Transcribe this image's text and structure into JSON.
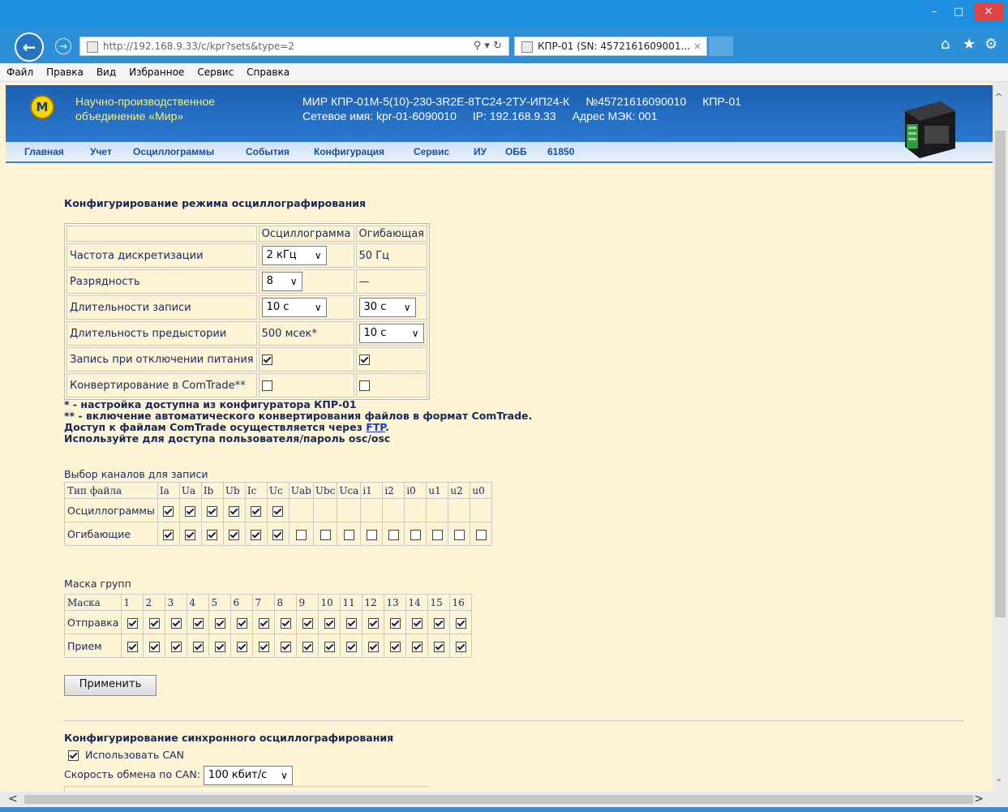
{
  "browser": {
    "url": "http://192.168.9.33/c/kpr?sets&type=2",
    "tab_title": "КПР-01 (SN: 4572161609001...",
    "tab_close": "×",
    "menu": [
      "Файл",
      "Правка",
      "Вид",
      "Избранное",
      "Сервис",
      "Справка"
    ],
    "window_buttons": {
      "minimize": "–",
      "maximize": "□",
      "close": "✕"
    }
  },
  "header": {
    "org_line1": "Научно-производственное",
    "org_line2": "объединение «Мир»",
    "model": "МИР КПР-01М-5(10)-230-3R2E-8TC24-2TУ-ИП24-К",
    "serial": "№45721616090010",
    "device": "КПР-01",
    "network_name": "Сетевое имя: kpr-01-6090010",
    "ip": "IP: 192.168.9.33",
    "iec_address": "Адрес МЭК: 001",
    "logo_text": "М"
  },
  "nav": [
    "Главная",
    "Учет",
    "Осциллограммы",
    "События",
    "Конфигурация",
    "Сервис",
    "ИУ",
    "ОББ",
    "61850"
  ],
  "oscillo_config": {
    "title": "Конфигурирование режима осциллографирования",
    "col_oscillogram": "Осциллограмма",
    "col_envelope": "Огибающая",
    "rows": {
      "sampling": {
        "label": "Частота дискретизации",
        "osc": "2 кГц",
        "env": "50 Гц"
      },
      "bits": {
        "label": "Разрядность",
        "osc": "8",
        "env": "—"
      },
      "duration": {
        "label": "Длительности записи",
        "osc": "10 с",
        "env": "30 с"
      },
      "prehistory": {
        "label": "Длительность предыстории",
        "osc": "500 мсек*",
        "env": "10 с"
      },
      "power_off": {
        "label": "Запись при отключении питания",
        "osc": true,
        "env": true
      },
      "comtrade": {
        "label": "Конвертирование в ComTrade**",
        "osc": false,
        "env": false
      }
    }
  },
  "notes": {
    "line1": "* - настройка доступна из конфигуратора КПР-01",
    "line2": "** - включение автоматического конвертирования файлов в формат ComTrade.",
    "line3_prefix": "Доступ к файлам ComTrade осуществляется через ",
    "line3_link": "FTP",
    "line3_suffix": ".",
    "line4": "Используйте для доступа пользователя/пароль osc/osc"
  },
  "channels": {
    "title": "Выбор каналов для записи",
    "type_header": "Тип файла",
    "names": [
      "Ia",
      "Ua",
      "Ib",
      "Ub",
      "Ic",
      "Uc",
      "Uab",
      "Ubc",
      "Uca",
      "i1",
      "i2",
      "i0",
      "u1",
      "u2",
      "u0"
    ],
    "oscillograms_label": "Осциллограммы",
    "oscillograms": [
      true,
      true,
      true,
      true,
      true,
      true,
      null,
      null,
      null,
      null,
      null,
      null,
      null,
      null,
      null
    ],
    "envelopes_label": "Огибающие",
    "envelopes": [
      true,
      true,
      true,
      true,
      true,
      true,
      false,
      false,
      false,
      false,
      false,
      false,
      false,
      false,
      false
    ]
  },
  "groups": {
    "title": "Маска групп",
    "mask_header": "Маска",
    "numbers": [
      "1",
      "2",
      "3",
      "4",
      "5",
      "6",
      "7",
      "8",
      "9",
      "10",
      "11",
      "12",
      "13",
      "14",
      "15",
      "16"
    ],
    "send_label": "Отправка",
    "send": [
      true,
      true,
      true,
      true,
      true,
      true,
      true,
      true,
      true,
      true,
      true,
      true,
      true,
      true,
      true,
      true
    ],
    "receive_label": "Прием",
    "receive": [
      true,
      true,
      true,
      true,
      true,
      true,
      true,
      true,
      true,
      true,
      true,
      true,
      true,
      true,
      true,
      true
    ]
  },
  "apply_button": "Применить",
  "sync": {
    "title": "Конфигурирование синхронного осциллографирования",
    "use_can_label": "Использовать CAN",
    "use_can": true,
    "speed_label": "Скорость обмена по CAN:",
    "speed_value": "100 кбит/с"
  }
}
